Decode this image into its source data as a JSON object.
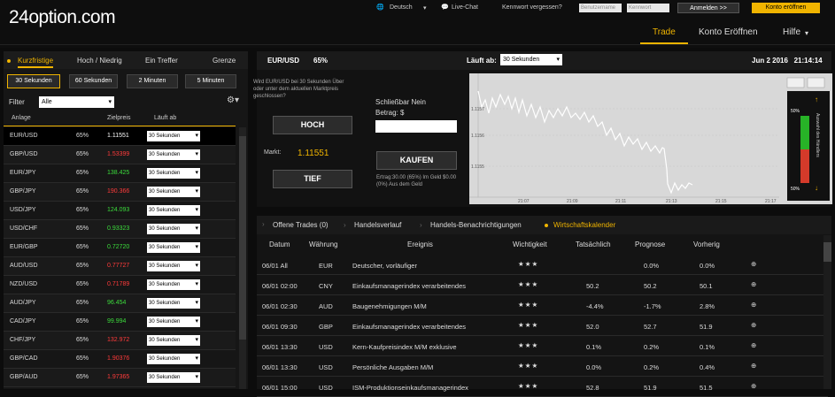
{
  "header": {
    "logo": "24option.com",
    "language": "Deutsch",
    "live_chat": "Live-Chat",
    "forgot_password": "Kennwort vergessen?",
    "username_placeholder": "Benutzername",
    "password_placeholder": "Kennwort",
    "login_button": "Anmelden >>",
    "open_account_button": "Konto eröffnen",
    "nav": [
      "Trade",
      "Konto Eröffnen",
      "Hilfe"
    ]
  },
  "left": {
    "tabs": [
      "Kurzfristige",
      "Hoch / Niedrig",
      "Ein Treffer",
      "Grenze"
    ],
    "time_buttons": [
      "30 Sekunden",
      "60 Sekunden",
      "2 Minuten",
      "5 Minuten"
    ],
    "filter_label": "Filter",
    "filter_value": "Alle",
    "columns": [
      "Anlage",
      "Zielpreis",
      "Läuft ab"
    ],
    "rows": [
      {
        "asset": "EUR/USD",
        "pct": "65%",
        "price": "1.11551",
        "color": "#ffffff",
        "expiry": "30 Sekunden"
      },
      {
        "asset": "GBP/USD",
        "pct": "65%",
        "price": "1.53399",
        "color": "#ff3b3b",
        "expiry": "30 Sekunden"
      },
      {
        "asset": "EUR/JPY",
        "pct": "65%",
        "price": "138.425",
        "color": "#3cdc3c",
        "expiry": "30 Sekunden"
      },
      {
        "asset": "GBP/JPY",
        "pct": "65%",
        "price": "190.366",
        "color": "#ff3b3b",
        "expiry": "30 Sekunden"
      },
      {
        "asset": "USD/JPY",
        "pct": "65%",
        "price": "124.093",
        "color": "#3cdc3c",
        "expiry": "30 Sekunden"
      },
      {
        "asset": "USD/CHF",
        "pct": "65%",
        "price": "0.93323",
        "color": "#3cdc3c",
        "expiry": "30 Sekunden"
      },
      {
        "asset": "EUR/GBP",
        "pct": "65%",
        "price": "0.72720",
        "color": "#3cdc3c",
        "expiry": "30 Sekunden"
      },
      {
        "asset": "AUD/USD",
        "pct": "65%",
        "price": "0.77727",
        "color": "#ff3b3b",
        "expiry": "30 Sekunden"
      },
      {
        "asset": "NZD/USD",
        "pct": "65%",
        "price": "0.71789",
        "color": "#ff3b3b",
        "expiry": "30 Sekunden"
      },
      {
        "asset": "AUD/JPY",
        "pct": "65%",
        "price": "96.454",
        "color": "#3cdc3c",
        "expiry": "30 Sekunden"
      },
      {
        "asset": "CAD/JPY",
        "pct": "65%",
        "price": "99.994",
        "color": "#3cdc3c",
        "expiry": "30 Sekunden"
      },
      {
        "asset": "CHF/JPY",
        "pct": "65%",
        "price": "132.972",
        "color": "#ff3b3b",
        "expiry": "30 Sekunden"
      },
      {
        "asset": "GBP/CAD",
        "pct": "65%",
        "price": "1.90376",
        "color": "#ff3b3b",
        "expiry": "30 Sekunden"
      },
      {
        "asset": "GBP/AUD",
        "pct": "65%",
        "price": "1.97365",
        "color": "#ff3b3b",
        "expiry": "30 Sekunden"
      }
    ]
  },
  "trade": {
    "asset": "EUR/USD",
    "pct": "65%",
    "expiry_label": "Läuft ab:",
    "expiry_value": "30 Sekunden",
    "datetime": "Jun 2 2016   21:14:14",
    "question": "Wird EUR/USD bei 30 Sekunden Über oder unter dem aktuellen Marktpreis geschlossen?",
    "hoch": "HOCH",
    "tief": "TIEF",
    "market_label": "Markt:",
    "market_value": "1.11551",
    "closable": "Schließbar Nein",
    "amount_label": "Betrag:  $",
    "buy": "KAUFEN",
    "yield": "Ertrag:30.00 (65%) Im Geld $0.00 (0%) Aus dem Geld",
    "chart_ylabels": [
      "1.1157",
      "1.1156",
      "1.1155"
    ],
    "chart_xlabels": [
      "21:07",
      "21:09",
      "21:11",
      "21:13",
      "21:15",
      "21:17"
    ],
    "sentiment_title": "Auswahl des Händlers",
    "sentiment_top": "50%",
    "sentiment_bottom": "50%"
  },
  "bottom": {
    "tabs": [
      "Offene Trades (0)",
      "Handelsverlauf",
      "Handels-Benachrichtigungen",
      "Wirtschaftskalender"
    ],
    "columns": [
      "Datum",
      "Währung",
      "Ereignis",
      "Wichtigkeit",
      "Tatsächlich",
      "Prognose",
      "Vorherig"
    ],
    "rows": [
      {
        "date": "06/01 All",
        "cur": "EUR",
        "event": "Deutscher, vorläufiger",
        "stars": 2,
        "actual": "",
        "forecast": "0.0%",
        "prev": "0.0%"
      },
      {
        "date": "06/01 02:00",
        "cur": "CNY",
        "event": "Einkaufsmanagerindex verarbeitendes",
        "stars": 3,
        "actual": "50.2",
        "forecast": "50.2",
        "prev": "50.1"
      },
      {
        "date": "06/01 02:30",
        "cur": "AUD",
        "event": "Baugenehmigungen M/M",
        "stars": 3,
        "actual": "-4.4%",
        "forecast": "-1.7%",
        "prev": "2.8%"
      },
      {
        "date": "06/01 09:30",
        "cur": "GBP",
        "event": "Einkaufsmanagerindex verarbeitendes",
        "stars": 3,
        "actual": "52.0",
        "forecast": "52.7",
        "prev": "51.9"
      },
      {
        "date": "06/01 13:30",
        "cur": "USD",
        "event": "Kern-Kaufpreisindex M/M exklusive",
        "stars": 2,
        "actual": "0.1%",
        "forecast": "0.2%",
        "prev": "0.1%"
      },
      {
        "date": "06/01 13:30",
        "cur": "USD",
        "event": "Persönliche Ausgaben M/M",
        "stars": 2,
        "actual": "0.0%",
        "forecast": "0.2%",
        "prev": "0.4%"
      },
      {
        "date": "06/01 15:00",
        "cur": "USD",
        "event": "ISM-Produktionseinkaufsmanagerindex",
        "stars": 3,
        "actual": "52.8",
        "forecast": "51.9",
        "prev": "51.5"
      }
    ]
  }
}
